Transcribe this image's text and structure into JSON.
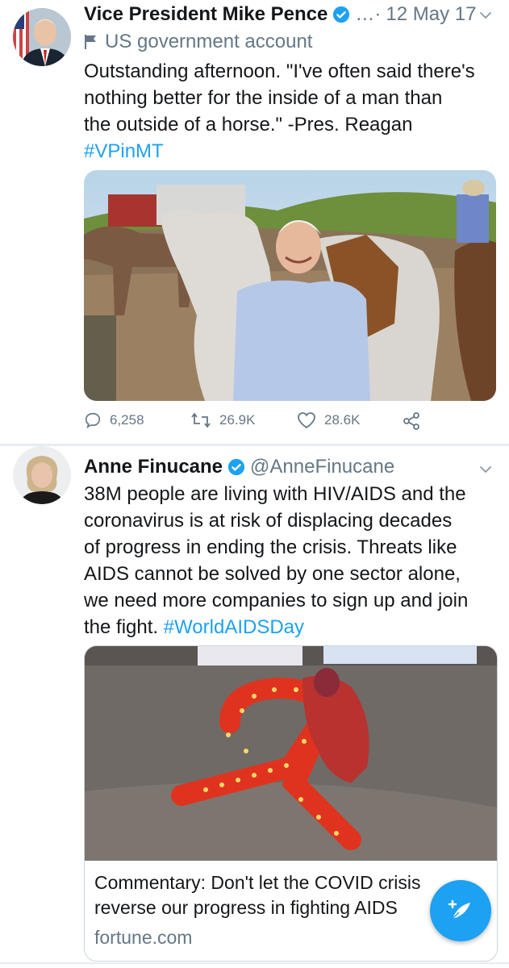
{
  "tweets": [
    {
      "author_name": "Vice President Mike Pence",
      "handle_separator": "…·",
      "date": "12 May 17",
      "account_label": "US government account",
      "text_line1": "Outstanding afternoon. \"I've often said there's",
      "text_line2": "nothing better for the inside of a man than",
      "text_line3": "the outside of a horse.\" -Pres. Reagan",
      "hashtag": "#VPinMT",
      "reply_count": "6,258",
      "retweet_count": "26.9K",
      "like_count": "28.6K"
    },
    {
      "author_name": "Anne Finucane",
      "handle": "@AnneFinucane",
      "text_line1": "38M people are living with HIV/AIDS and the",
      "text_line2": "coronavirus is at risk of displacing decades",
      "text_line3": "of progress in ending the crisis. Threats like",
      "text_line4": "AIDS cannot be solved by one sector alone,",
      "text_line5": "we need more companies to sign up and join",
      "text_line6": "the fight. ",
      "hashtag": "#WorldAIDSDay",
      "card_title_line1": "Commentary: Don't let the COVID crisis",
      "card_title_line2": "reverse our progress in fighting AIDS",
      "card_domain": "fortune.com"
    }
  ],
  "colors": {
    "accent": "#1da1f2",
    "secondary_text": "#657786",
    "primary_text": "#14171a"
  },
  "icons": {
    "verified": "verified-badge-icon",
    "flag": "flag-icon",
    "chevron": "chevron-down-icon",
    "reply": "reply-icon",
    "retweet": "retweet-icon",
    "like": "heart-icon",
    "share": "share-icon",
    "compose": "compose-feather-icon"
  }
}
